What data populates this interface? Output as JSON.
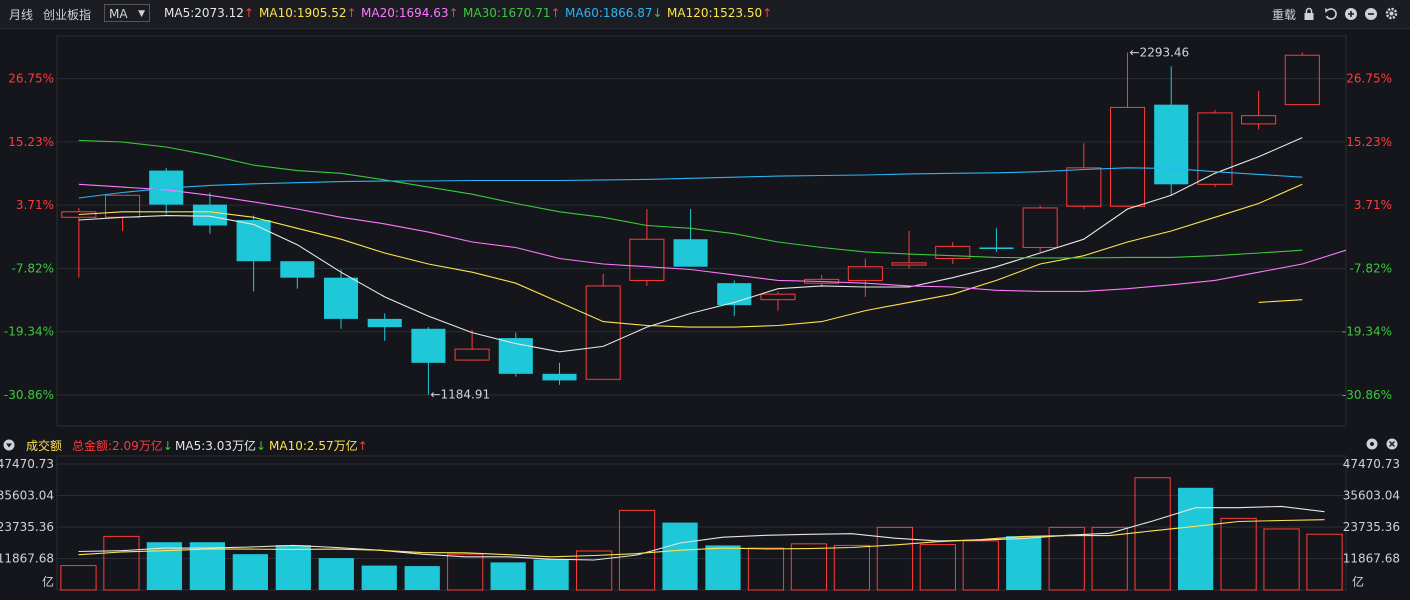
{
  "toolbar": {
    "period": "月线",
    "index_name": "创业板指",
    "indicator": "MA",
    "reload": "重载",
    "ma_labels": [
      {
        "text": "MA5:2073.12",
        "arrow": "↑",
        "color": "#e6e6e6",
        "arrow_color": "#ff3b3b"
      },
      {
        "text": "MA10:1905.52",
        "arrow": "↑",
        "color": "#ffe34d",
        "arrow_color": "#ff3b3b"
      },
      {
        "text": "MA20:1694.63",
        "arrow": "↑",
        "color": "#ff77ff",
        "arrow_color": "#ff3b3b"
      },
      {
        "text": "MA30:1670.71",
        "arrow": "↑",
        "color": "#3cc83c",
        "arrow_color": "#ff3b3b"
      },
      {
        "text": "MA60:1866.87",
        "arrow": "↓",
        "color": "#29b6f6",
        "arrow_color": "#3cc83c"
      },
      {
        "text": "MA120:1523.50",
        "arrow": "↑",
        "color": "#ffe34d",
        "arrow_color": "#ff3b3b"
      }
    ]
  },
  "volume_bar": {
    "title": "成交额",
    "total": "总金额:2.09万亿",
    "total_arrow": "↓",
    "ma5": "MA5:3.03万亿",
    "ma5_arrow": "↓",
    "ma10": "MA10:2.57万亿",
    "ma10_arrow": "↑",
    "unit": "亿"
  },
  "colors": {
    "up": "#ff3b3b",
    "down": "#1fc8d8",
    "grid": "#2a2d33",
    "bg": "#14161b"
  },
  "chart_data": [
    {
      "type": "candlestick",
      "title": "",
      "y_tick_labels": [
        "26.75%",
        "15.23%",
        "3.71%",
        "-7.82%",
        "-19.34%",
        "-30.86%"
      ],
      "y_ticks_pct": [
        26.75,
        15.23,
        3.71,
        -7.82,
        -19.34,
        -30.86
      ],
      "ylim_pct": [
        -36.5,
        34.5
      ],
      "grid": true,
      "annotations": [
        {
          "text": "←2293.46",
          "candle": 24,
          "at": "high"
        },
        {
          "text": "←1184.91",
          "candle": 8,
          "at": "low"
        }
      ],
      "candles_pct": [
        {
          "o": 1.5,
          "c": 2.5,
          "h": 3.2,
          "l": -9.5
        },
        {
          "o": 1.5,
          "c": 5.5,
          "h": 5.0,
          "l": -1.0
        },
        {
          "o": 10.0,
          "c": 3.8,
          "h": 10.5,
          "l": 2.0
        },
        {
          "o": 3.8,
          "c": 0.0,
          "h": 6.0,
          "l": -1.5
        },
        {
          "o": 1.0,
          "c": -6.5,
          "h": 1.8,
          "l": -12.0
        },
        {
          "o": -6.5,
          "c": -9.5,
          "h": -6.5,
          "l": -11.5
        },
        {
          "o": -9.5,
          "c": -17.0,
          "h": -8.0,
          "l": -18.8
        },
        {
          "o": -17.0,
          "c": -18.5,
          "h": -16.0,
          "l": -21.0
        },
        {
          "o": -18.8,
          "c": -25.0,
          "h": -18.5,
          "l": -30.8
        },
        {
          "o": -24.5,
          "c": -22.5,
          "h": -19.0,
          "l": -24.5
        },
        {
          "o": -20.5,
          "c": -27.0,
          "h": -19.5,
          "l": -27.5
        },
        {
          "o": -27.0,
          "c": -28.2,
          "h": -25.0,
          "l": -29.0
        },
        {
          "o": -28.0,
          "c": -11.0,
          "h": -8.8,
          "l": -27.8
        },
        {
          "o": -10.0,
          "c": -2.5,
          "h": 3.0,
          "l": -11.0
        },
        {
          "o": -2.5,
          "c": -7.5,
          "h": 3.0,
          "l": -7.5
        },
        {
          "o": -10.5,
          "c": -14.5,
          "h": -10.0,
          "l": -16.5
        },
        {
          "o": -13.5,
          "c": -12.5,
          "h": -12.0,
          "l": -15.5
        },
        {
          "o": -10.5,
          "c": -9.8,
          "h": -9.0,
          "l": -11.2
        },
        {
          "o": -10.0,
          "c": -7.5,
          "h": -6.0,
          "l": -13.0
        },
        {
          "o": -7.2,
          "c": -6.8,
          "h": -1.0,
          "l": -7.8
        },
        {
          "o": -6.0,
          "c": -3.8,
          "h": -3.0,
          "l": -7.0
        },
        {
          "o": -4.0,
          "c": -4.2,
          "h": -0.5,
          "l": -4.8
        },
        {
          "o": -4.0,
          "c": 3.2,
          "h": 3.6,
          "l": -4.8
        },
        {
          "o": 3.5,
          "c": 10.5,
          "h": 15.0,
          "l": 3.0
        },
        {
          "o": 3.5,
          "c": 21.5,
          "h": 31.5,
          "l": 3.5
        },
        {
          "o": 22.0,
          "c": 7.5,
          "h": 29.0,
          "l": 5.5
        },
        {
          "o": 7.5,
          "c": 20.5,
          "h": 21.0,
          "l": 7.0
        },
        {
          "o": 18.5,
          "c": 20.0,
          "h": 24.5,
          "l": 17.5
        },
        {
          "o": 22.0,
          "c": 31.0,
          "h": 31.5,
          "l": 22.0
        }
      ],
      "series": [
        {
          "name": "MA5",
          "color": "#e6e6e6",
          "values": [
            1.0,
            1.5,
            1.8,
            1.7,
            0.2,
            -3.5,
            -8.5,
            -13.0,
            -16.5,
            -19.5,
            -21.5,
            -23.0,
            -22.0,
            -18.5,
            -16.0,
            -14.0,
            -11.5,
            -11.0,
            -11.2,
            -11.2,
            -9.5,
            -7.5,
            -5.0,
            -2.5,
            3.0,
            5.5,
            9.5,
            12.5,
            16.0
          ]
        },
        {
          "name": "MA10",
          "color": "#ffe34d",
          "values": [
            2.0,
            2.5,
            2.5,
            2.5,
            1.5,
            -0.5,
            -2.5,
            -5.0,
            -7.0,
            -8.5,
            -10.5,
            -14.0,
            -17.5,
            -18.2,
            -18.5,
            -18.5,
            -18.2,
            -17.5,
            -15.5,
            -14.0,
            -12.5,
            -10.0,
            -7.0,
            -5.5,
            -3.0,
            -1.0,
            1.5,
            4.0,
            7.5
          ]
        },
        {
          "name": "MA20",
          "color": "#ff77ff",
          "values": [
            7.5,
            7.0,
            6.5,
            5.5,
            4.3,
            3.0,
            1.5,
            0.3,
            -1.2,
            -3.0,
            -4.0,
            -6.0,
            -7.0,
            -7.5,
            -8.0,
            -9.0,
            -10.0,
            -10.2,
            -10.5,
            -11.0,
            -11.2,
            -11.8,
            -12.0,
            -12.0,
            -11.5,
            -10.8,
            -10.0,
            -8.5,
            -7.0,
            -4.5
          ]
        },
        {
          "name": "MA30",
          "color": "#3cc83c",
          "values": [
            15.5,
            15.2,
            14.3,
            12.8,
            11.0,
            10.0,
            9.5,
            8.3,
            7.0,
            5.7,
            4.0,
            2.5,
            1.5,
            0.0,
            -0.5,
            -1.5,
            -3.0,
            -4.0,
            -4.8,
            -5.2,
            -5.5,
            -5.8,
            -5.9,
            -5.9,
            -5.8,
            -5.8,
            -5.5,
            -5.0,
            -4.5
          ]
        },
        {
          "name": "MA60",
          "color": "#29b6f6",
          "values": [
            5.0,
            6.0,
            6.8,
            7.3,
            7.6,
            7.8,
            8.0,
            8.1,
            8.1,
            8.2,
            8.2,
            8.2,
            8.3,
            8.4,
            8.6,
            8.8,
            9.0,
            9.1,
            9.2,
            9.4,
            9.5,
            9.6,
            9.8,
            10.2,
            10.5,
            10.4,
            9.8,
            9.3,
            8.8
          ]
        },
        {
          "name": "MA120",
          "color": "#ffe34d",
          "values": [
            null,
            null,
            null,
            null,
            null,
            null,
            null,
            null,
            null,
            null,
            null,
            null,
            null,
            null,
            null,
            null,
            null,
            null,
            null,
            null,
            null,
            null,
            null,
            null,
            null,
            null,
            null,
            -14.0,
            -13.5
          ]
        }
      ]
    },
    {
      "type": "bar",
      "title": "",
      "y_tick_labels": [
        "47470.73",
        "35603.04",
        "23735.36",
        "11867.68"
      ],
      "y_ticks": [
        47470.73,
        35603.04,
        23735.36,
        11867.68
      ],
      "ylim": [
        0,
        47470.73
      ],
      "values": [
        9200,
        20200,
        18000,
        18000,
        13500,
        16900,
        12000,
        9200,
        9000,
        13500,
        10400,
        11500,
        14700,
        30000,
        25400,
        16800,
        15800,
        17400,
        16800,
        23600,
        17100,
        18500,
        20300,
        23600,
        23600,
        42300,
        38500,
        27000,
        23000,
        21000
      ],
      "up": [
        true,
        true,
        false,
        false,
        false,
        false,
        false,
        false,
        false,
        true,
        false,
        false,
        true,
        true,
        false,
        false,
        true,
        true,
        true,
        true,
        true,
        true,
        false,
        true,
        true,
        true,
        false,
        true,
        true,
        true
      ],
      "series": [
        {
          "name": "MA5",
          "color": "#e6e6e6",
          "values": [
            14500,
            14800,
            15800,
            15800,
            16200,
            16800,
            16000,
            15000,
            13500,
            12500,
            12500,
            11600,
            11300,
            13200,
            17700,
            19900,
            20600,
            21000,
            21200,
            19500,
            18500,
            18800,
            19400,
            20600,
            21400,
            26000,
            31000,
            31000,
            31500,
            29500
          ]
        },
        {
          "name": "MA10",
          "color": "#ffe34d",
          "values": [
            13300,
            14300,
            14800,
            15400,
            15400,
            15300,
            15400,
            15000,
            14100,
            14000,
            13300,
            12500,
            13000,
            13700,
            15000,
            15800,
            15500,
            15600,
            16000,
            17000,
            18200,
            19000,
            20200,
            20500,
            20500,
            22300,
            24000,
            25800,
            26200,
            26500
          ]
        }
      ]
    }
  ]
}
